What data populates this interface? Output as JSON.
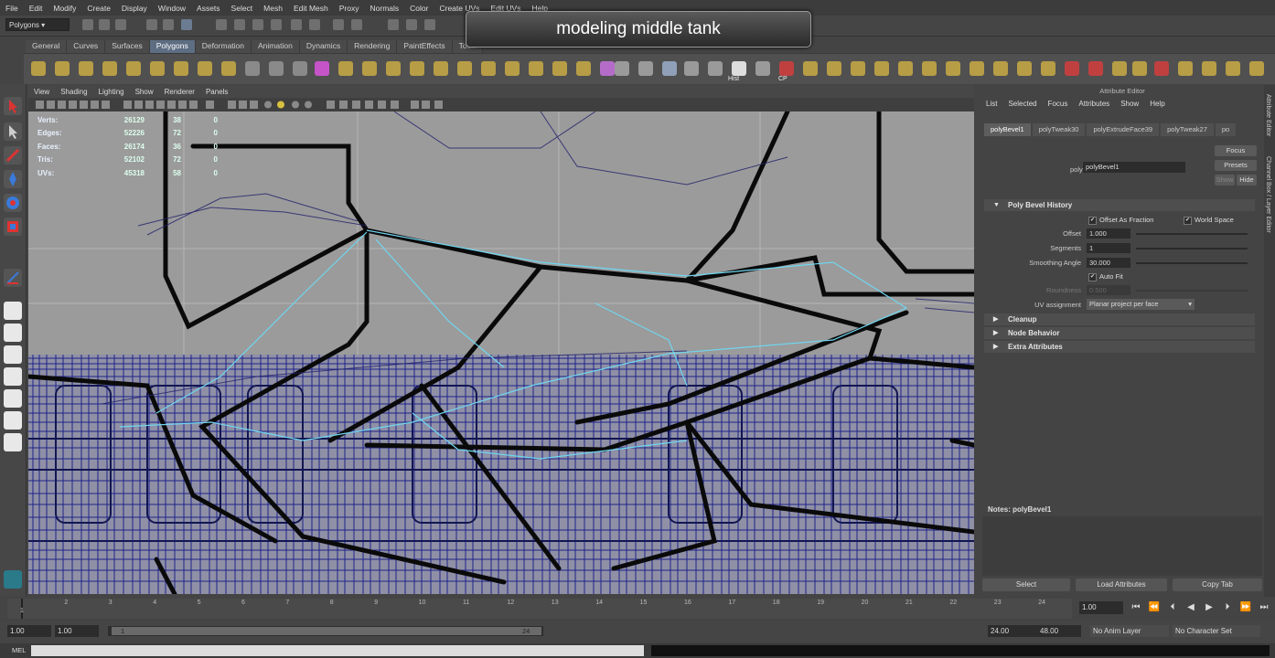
{
  "overlay": {
    "title": "modeling middle tank"
  },
  "menubar": [
    "File",
    "Edit",
    "Modify",
    "Create",
    "Display",
    "Window",
    "Assets",
    "Select",
    "Mesh",
    "Edit Mesh",
    "Proxy",
    "Normals",
    "Color",
    "Create UVs",
    "Edit UVs",
    "Help"
  ],
  "statusline": {
    "mode": "Polygons"
  },
  "shelf_tabs": [
    {
      "label": "General",
      "active": false
    },
    {
      "label": "Curves",
      "active": false
    },
    {
      "label": "Surfaces",
      "active": false
    },
    {
      "label": "Polygons",
      "active": true
    },
    {
      "label": "Deformation",
      "active": false
    },
    {
      "label": "Animation",
      "active": false
    },
    {
      "label": "Dynamics",
      "active": false
    },
    {
      "label": "Rendering",
      "active": false
    },
    {
      "label": "PaintEffects",
      "active": false
    },
    {
      "label": "Toon",
      "active": false
    }
  ],
  "shelf_icons": {
    "hist_label": "Hist",
    "cp_label": "CP"
  },
  "viewport": {
    "menu": [
      "View",
      "Shading",
      "Lighting",
      "Show",
      "Renderer",
      "Panels"
    ],
    "hud": [
      {
        "label": "Verts:",
        "v1": "26129",
        "v2": "38",
        "v3": "0"
      },
      {
        "label": "Edges:",
        "v1": "52226",
        "v2": "72",
        "v3": "0"
      },
      {
        "label": "Faces:",
        "v1": "26174",
        "v2": "36",
        "v3": "0"
      },
      {
        "label": "Tris:",
        "v1": "52102",
        "v2": "72",
        "v3": "0"
      },
      {
        "label": "UVs:",
        "v1": "45318",
        "v2": "58",
        "v3": "0"
      }
    ]
  },
  "attribute_editor": {
    "header": "Attribute Editor",
    "menu": [
      "List",
      "Selected",
      "Focus",
      "Attributes",
      "Show",
      "Help"
    ],
    "tabs": [
      {
        "label": "polyBevel1",
        "active": true
      },
      {
        "label": "polyTweak30",
        "active": false
      },
      {
        "label": "polyExtrudeFace39",
        "active": false
      },
      {
        "label": "polyTweak27",
        "active": false
      },
      {
        "label": "po",
        "active": false
      }
    ],
    "node_label": "polyBevel:",
    "node_value": "polyBevel1",
    "focus_btn": "Focus",
    "presets_btn": "Presets",
    "show_btn": "Show",
    "hide_btn": "Hide",
    "section_history": "Poly Bevel History",
    "offset_as_fraction": "Offset As Fraction",
    "world_space": "World Space",
    "offset_label": "Offset",
    "offset_value": "1.000",
    "segments_label": "Segments",
    "segments_value": "1",
    "smoothing_label": "Smoothing Angle",
    "smoothing_value": "30.000",
    "autofit_label": "Auto Fit",
    "roundness_label": "Roundness",
    "roundness_value": "0.500",
    "uv_label": "UV assignment",
    "uv_value": "Planar project per face",
    "sections": [
      "Cleanup",
      "Node Behavior",
      "Extra Attributes"
    ],
    "notes": "Notes:  polyBevel1",
    "buttons": [
      "Select",
      "Load Attributes",
      "Copy Tab"
    ]
  },
  "side_tabs": [
    "Attribute Editor",
    "Channel Box / Layer Editor"
  ],
  "timeline": {
    "ticks": [
      "1",
      "2",
      "3",
      "4",
      "5",
      "6",
      "7",
      "8",
      "9",
      "10",
      "11",
      "12",
      "13",
      "14",
      "15",
      "16",
      "17",
      "18",
      "19",
      "20",
      "21",
      "22",
      "23",
      "24"
    ],
    "current_frame": "1.00"
  },
  "range": {
    "start": "1.00",
    "start2": "1.00",
    "thumb_start": "1",
    "thumb_end": "24",
    "end": "24.00",
    "end2": "48.00",
    "anim_layer": "No Anim Layer",
    "char_set": "No Character Set"
  },
  "cmdline": {
    "label": "MEL"
  }
}
